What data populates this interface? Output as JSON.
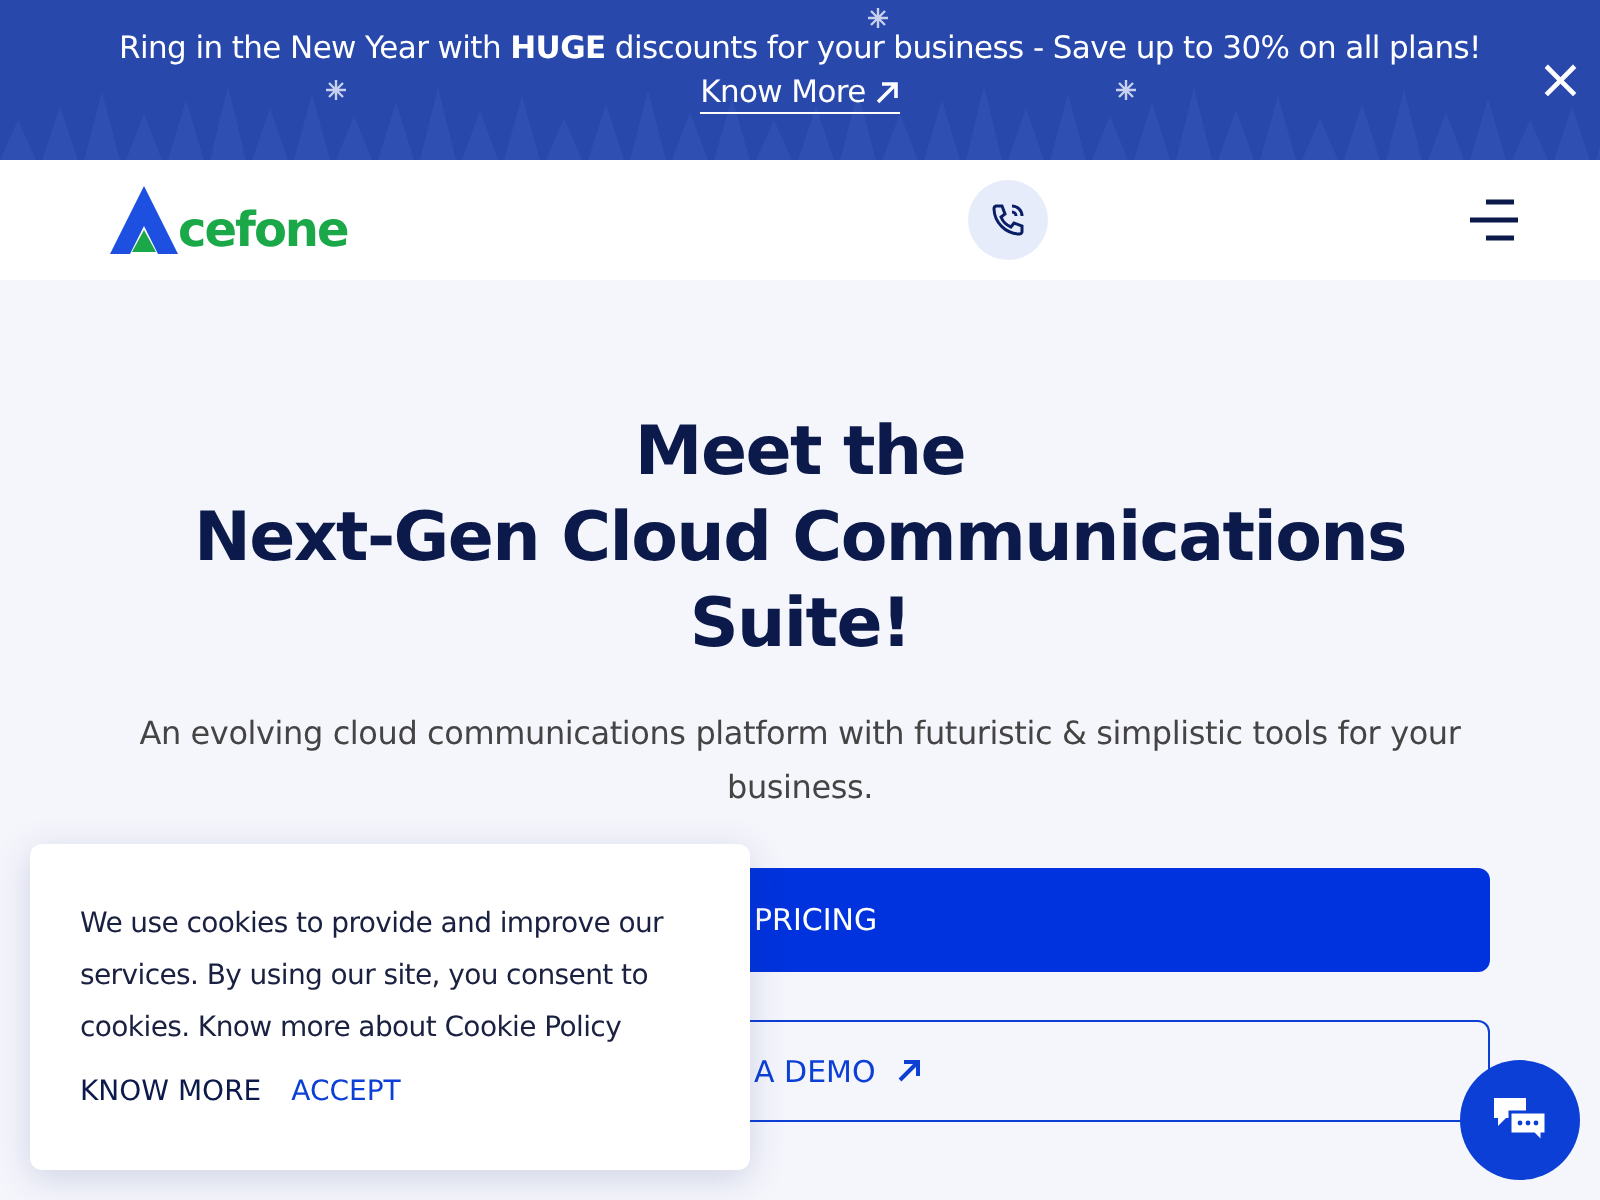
{
  "banner": {
    "message": "Ring in the New Year with **HUGE** discounts for your business - Save up to 30% on all plans!",
    "link": "Know More",
    "close": "×"
  },
  "header": {
    "logo": "cefone"
  },
  "hero": {
    "title_lines": [
      "Meet the",
      "Next-Gen Cloud Communications",
      "Suite!"
    ],
    "subtitle": "An evolving cloud communications platform with futuristic & simplistic tools for your business.",
    "buttons": [
      {
        "kind": "primary",
        "label": "PRICING"
      },
      {
        "kind": "outline",
        "label": "A DEMO"
      }
    ]
  },
  "cookie": {
    "text": "We use cookies to provide and improve our services. By using our site, you consent to cookies. Know more about Cookie Policy",
    "actions": [
      {
        "kind": "secondary",
        "label": "KNOW MORE"
      },
      {
        "kind": "primary",
        "label": "ACCEPT"
      }
    ]
  }
}
